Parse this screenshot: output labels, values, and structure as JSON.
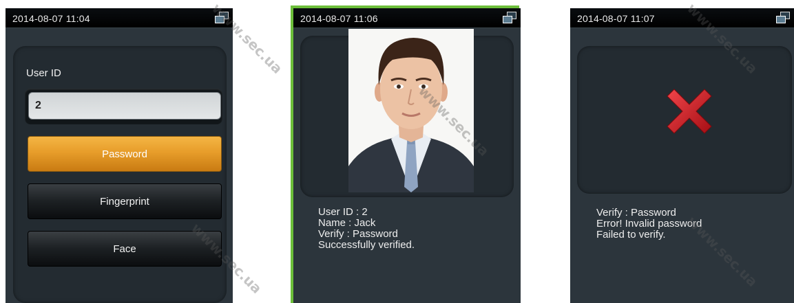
{
  "screen_identify": {
    "time": "2014-08-07 11:04",
    "user_id_label": "User ID",
    "user_id_value": "2",
    "buttons": [
      "Password",
      "Fingerprint",
      "Face"
    ]
  },
  "screen_success": {
    "time": "2014-08-07 11:06",
    "lines": [
      "User ID : 2",
      "Name : Jack",
      "Verify : Password",
      "Successfully verified."
    ]
  },
  "screen_fail": {
    "time": "2014-08-07 11:07",
    "lines": [
      "Verify : Password",
      "Error! Invalid password",
      "Failed to verify."
    ]
  },
  "watermark": "www.sec.ua",
  "icons": {
    "network": "network-status-icon",
    "fail": "red-cross-icon",
    "photo": "user-photo"
  },
  "colors": {
    "accent_orange": "#e79d2a",
    "highlight_green": "#6cbe3a",
    "error_red": "#c8121a",
    "screen_bg": "#2c353c"
  }
}
